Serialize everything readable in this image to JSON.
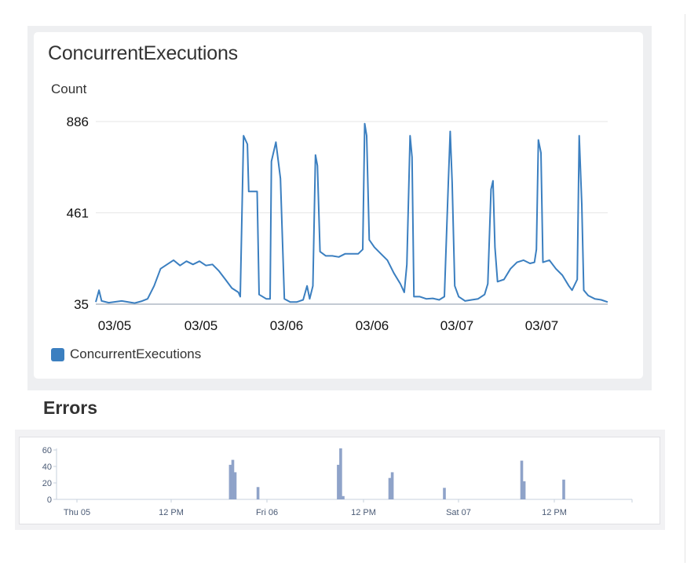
{
  "main_panel": {
    "title": "ConcurrentExecutions",
    "unit": "Count",
    "legend_label": "ConcurrentExecutions"
  },
  "errors_panel": {
    "title": "Errors"
  },
  "colors": {
    "line": "#3b7fc0",
    "bars": "#8fa3c9",
    "grid": "#e6e6e6",
    "axis": "#c7d0dc"
  },
  "chart_data": [
    {
      "type": "line",
      "title": "ConcurrentExecutions",
      "ylabel": "Count",
      "xlabel": "",
      "ylim": [
        35,
        886
      ],
      "yticks": [
        35,
        461,
        886
      ],
      "xtick_labels": [
        "03/05",
        "03/05",
        "03/06",
        "03/06",
        "03/07",
        "03/07"
      ],
      "x_range_hours": [
        0,
        72
      ],
      "grid": true,
      "legend_position": "bottom-left",
      "series": [
        {
          "name": "ConcurrentExecutions",
          "points": [
            [
              0,
              45
            ],
            [
              0.5,
              100
            ],
            [
              0.9,
              50
            ],
            [
              2,
              42
            ],
            [
              4,
              50
            ],
            [
              6,
              40
            ],
            [
              7,
              48
            ],
            [
              8,
              60
            ],
            [
              9,
              120
            ],
            [
              10,
              200
            ],
            [
              11,
              220
            ],
            [
              12,
              240
            ],
            [
              13,
              215
            ],
            [
              14,
              235
            ],
            [
              15,
              220
            ],
            [
              16,
              235
            ],
            [
              17,
              215
            ],
            [
              18,
              220
            ],
            [
              19,
              190
            ],
            [
              20,
              150
            ],
            [
              21,
              110
            ],
            [
              22,
              90
            ],
            [
              22.3,
              70
            ],
            [
              22.8,
              820
            ],
            [
              23.4,
              780
            ],
            [
              23.6,
              560
            ],
            [
              24.9,
              560
            ],
            [
              25.2,
              80
            ],
            [
              26.3,
              60
            ],
            [
              26.9,
              60
            ],
            [
              27.1,
              700
            ],
            [
              27.8,
              790
            ],
            [
              28.5,
              620
            ],
            [
              29.1,
              60
            ],
            [
              30,
              45
            ],
            [
              31,
              45
            ],
            [
              32,
              55
            ],
            [
              32.6,
              120
            ],
            [
              33,
              60
            ],
            [
              33.5,
              120
            ],
            [
              33.9,
              730
            ],
            [
              34.2,
              680
            ],
            [
              34.6,
              280
            ],
            [
              35.5,
              260
            ],
            [
              36.5,
              260
            ],
            [
              37.5,
              255
            ],
            [
              38.5,
              270
            ],
            [
              39.5,
              270
            ],
            [
              40.5,
              270
            ],
            [
              41.2,
              290
            ],
            [
              41.5,
              876
            ],
            [
              41.8,
              820
            ],
            [
              42.2,
              335
            ],
            [
              43,
              300
            ],
            [
              44,
              270
            ],
            [
              45,
              240
            ],
            [
              46,
              180
            ],
            [
              47,
              130
            ],
            [
              47.6,
              90
            ],
            [
              48,
              220
            ],
            [
              48.5,
              820
            ],
            [
              48.8,
              720
            ],
            [
              49.1,
              70
            ],
            [
              50,
              70
            ],
            [
              51,
              60
            ],
            [
              52,
              62
            ],
            [
              53,
              55
            ],
            [
              53.8,
              70
            ],
            [
              54.4,
              600
            ],
            [
              54.7,
              840
            ],
            [
              55,
              600
            ],
            [
              55.4,
              120
            ],
            [
              56,
              70
            ],
            [
              57,
              50
            ],
            [
              58,
              55
            ],
            [
              59,
              60
            ],
            [
              60,
              80
            ],
            [
              60.5,
              130
            ],
            [
              61,
              570
            ],
            [
              61.3,
              610
            ],
            [
              61.6,
              300
            ],
            [
              62,
              140
            ],
            [
              63,
              150
            ],
            [
              64,
              200
            ],
            [
              65,
              230
            ],
            [
              66,
              240
            ],
            [
              67,
              225
            ],
            [
              67.7,
              230
            ],
            [
              68,
              290
            ],
            [
              68.3,
              800
            ],
            [
              68.7,
              740
            ],
            [
              69,
              230
            ],
            [
              70,
              240
            ],
            [
              71,
              200
            ],
            [
              72,
              170
            ],
            [
              73,
              120
            ],
            [
              73.5,
              100
            ],
            [
              74.3,
              150
            ],
            [
              74.6,
              820
            ],
            [
              75,
              500
            ],
            [
              75.3,
              100
            ],
            [
              76,
              75
            ],
            [
              77,
              60
            ],
            [
              78,
              55
            ],
            [
              79,
              45
            ]
          ]
        }
      ]
    },
    {
      "type": "bar",
      "title": "Errors",
      "ylim": [
        0,
        60
      ],
      "yticks": [
        0,
        20,
        40,
        60
      ],
      "xtick_labels": [
        "Thu 05",
        "12 PM",
        "Fri 06",
        "12 PM",
        "Sat 07",
        "12 PM"
      ],
      "x_range_hours": [
        0,
        72
      ],
      "grid": false,
      "series": [
        {
          "name": "",
          "points": [
            [
              29.0,
              42
            ],
            [
              29.4,
              48
            ],
            [
              29.8,
              33
            ],
            [
              33.6,
              15
            ],
            [
              47.0,
              42
            ],
            [
              47.4,
              62
            ],
            [
              47.8,
              4
            ],
            [
              55.6,
              26
            ],
            [
              56.0,
              33
            ],
            [
              64.7,
              14
            ],
            [
              77.6,
              47
            ],
            [
              78.0,
              22
            ],
            [
              84.6,
              24
            ]
          ]
        }
      ]
    }
  ]
}
